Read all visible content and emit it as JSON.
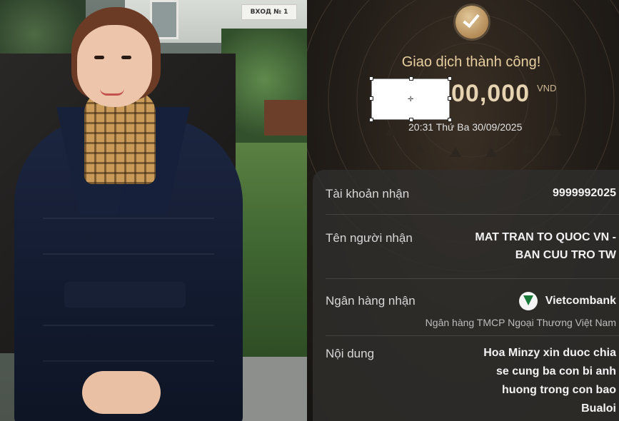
{
  "photo": {
    "sign_text": "ВХОД № 1"
  },
  "receipt": {
    "status_title": "Giao dịch thành công!",
    "amount_visible": "00,000",
    "currency": "VND",
    "datetime": "20:31 Thứ Ba 30/09/2025",
    "icons": {
      "success": "check-circle-icon",
      "bank_logo": "vietcombank-logo-icon",
      "selection_move": "move-crosshair-icon"
    },
    "colors": {
      "gold": "#e8cfa0",
      "card_bg": "#302e2c",
      "redaction": "#ffffff"
    },
    "rows": {
      "account_label": "Tài khoản nhận",
      "account_value": "9999992025",
      "recipient_label": "Tên người nhận",
      "recipient_value_line1": "MAT TRAN TO QUOC VN -",
      "recipient_value_line2": "BAN CUU TRO TW",
      "bank_label": "Ngân hàng nhận",
      "bank_name": "Vietcombank",
      "bank_full_name": "Ngân hàng TMCP Ngoại Thương Việt Nam",
      "content_label": "Nội dung",
      "content_line1": "Hoa Minzy xin duoc chia",
      "content_line2": "se cung ba con bi anh",
      "content_line3": "huong trong con bao",
      "content_line4": "Bualoi"
    }
  }
}
